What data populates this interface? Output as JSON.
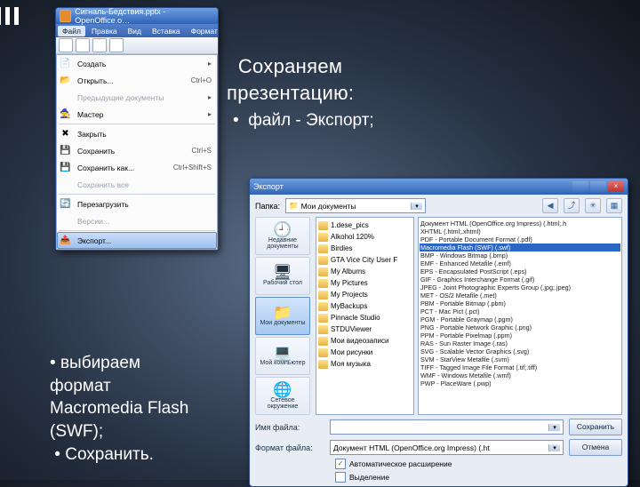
{
  "slide": {
    "heading_l1": "Сохраняем",
    "heading_l2": "презентацию:",
    "bullet1": "файл - Экспорт;",
    "bullet2_l1": "выбираем",
    "bullet2_l2": "формат",
    "bullet2_l3": "Macromedia Flash",
    "bullet2_l4": "(SWF);",
    "bullet3": "Сохранить."
  },
  "sc1": {
    "title": "Сигналь-Бедствия.pptx - OpenOffice.o…",
    "menubar": [
      "Файл",
      "Правка",
      "Вид",
      "Вставка",
      "Формат"
    ],
    "items": [
      {
        "ico": "📄",
        "label": "Создать",
        "sub": true
      },
      {
        "ico": "📂",
        "label": "Открыть...",
        "short": "Ctrl+O"
      },
      {
        "ico": "",
        "label": "Предыдущие документы",
        "sub": true,
        "dis": true
      },
      {
        "ico": "🧙",
        "label": "Мастер",
        "sub": true
      },
      {
        "sep": true
      },
      {
        "ico": "✖",
        "label": "Закрыть"
      },
      {
        "ico": "💾",
        "label": "Сохранить",
        "short": "Ctrl+S"
      },
      {
        "ico": "💾",
        "label": "Сохранить как...",
        "short": "Ctrl+Shift+S"
      },
      {
        "ico": "",
        "label": "Сохранить все",
        "dis": true
      },
      {
        "sep": true
      },
      {
        "ico": "🔄",
        "label": "Перезагрузить"
      },
      {
        "ico": "",
        "label": "Версии...",
        "dis": true
      },
      {
        "sep": true
      },
      {
        "ico": "📤",
        "label": "Экспорт...",
        "hl": true
      }
    ]
  },
  "sc2": {
    "title": "Экспорт",
    "folder_label": "Папка:",
    "folder_value": "Мои документы",
    "places": [
      {
        "ico": "🕘",
        "l1": "Недавние",
        "l2": "документы"
      },
      {
        "ico": "🖥",
        "l1": "Рабочий стол",
        "l2": ""
      },
      {
        "ico": "📁",
        "l1": "Мои документы",
        "l2": "",
        "sel": true
      },
      {
        "ico": "💻",
        "l1": "Мой компьютер",
        "l2": ""
      },
      {
        "ico": "🌐",
        "l1": "Сетевое",
        "l2": "окружение"
      }
    ],
    "folders": [
      "1.dese_pics",
      "Alkohol 120%",
      "Birdies",
      "GTA Vice City User F",
      "My Albums",
      "My Pictures",
      "My Projects",
      "MyBackups",
      "Pinnacle Studio",
      "STDUViewer",
      "Мои видеозаписи",
      "Мои рисунки",
      "Моя музыка"
    ],
    "types": [
      "Документ HTML (OpenOffice.org Impress) (.html;.h",
      "XHTML (.html;.xhtml)",
      "PDF - Portable Document Format (.pdf)",
      "Macromedia Flash (SWF) (.swf)",
      "BMP - Windows Bitmap (.bmp)",
      "EMF - Enhanced Metafile (.emf)",
      "EPS - Encapsulated PostScript (.eps)",
      "GIF - Graphics Interchange Format (.gif)",
      "JPEG - Joint Photographic Experts Group (.jpg;.jpeg)",
      "MET - OS/2 Metafile (.met)",
      "PBM - Portable Bitmap (.pbm)",
      "PCT - Mac Pict (.pct)",
      "PGM - Portable Graymap (.pgm)",
      "PNG - Portable Network Graphic (.png)",
      "PPM - Portable Pixelmap (.ppm)",
      "RAS - Sun Raster Image (.ras)",
      "SVG - Scalable Vector Graphics (.svg)",
      "SVM - StarView Metafile (.svm)",
      "TIFF - Tagged Image File Format (.tif;.tiff)",
      "WMF - Windows Metafile (.wmf)",
      "PWP - PlaceWare (.pwp)"
    ],
    "types_hl_index": 3,
    "filename_label": "Имя файла:",
    "filename_value": "",
    "filetype_label": "Формат файла:",
    "filetype_value": "Документ HTML (OpenOffice.org Impress) (.ht",
    "btn_save": "Сохранить",
    "btn_cancel": "Отмена",
    "chk_autoext": "Автоматическое расширение",
    "chk_selection": "Выделение"
  }
}
